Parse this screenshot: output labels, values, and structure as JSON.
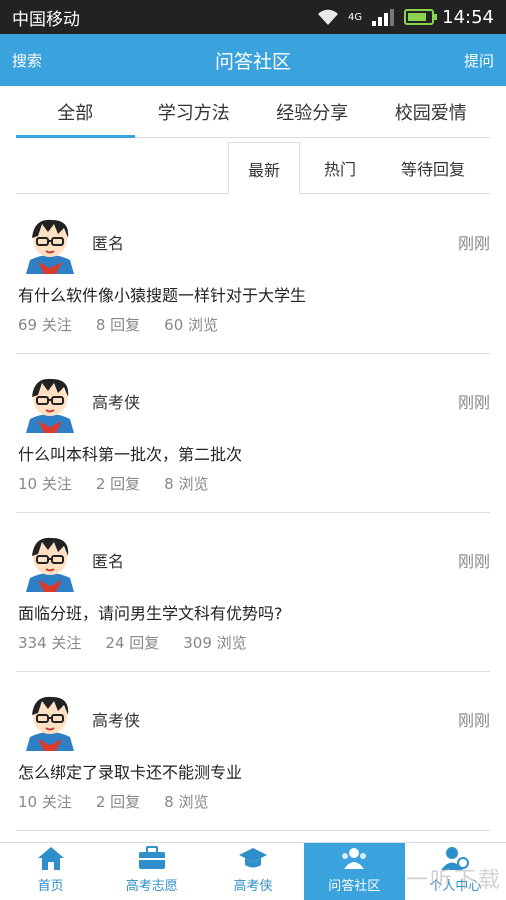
{
  "status_bar": {
    "carrier": "中国移动",
    "network": "4G",
    "time": "14:54"
  },
  "header": {
    "left": "搜索",
    "title": "问答社区",
    "right": "提问"
  },
  "categories": [
    {
      "label": "全部",
      "active": true
    },
    {
      "label": "学习方法",
      "active": false
    },
    {
      "label": "经验分享",
      "active": false
    },
    {
      "label": "校园爱情",
      "active": false
    }
  ],
  "sort_tabs": [
    {
      "label": "最新",
      "active": true
    },
    {
      "label": "热门",
      "active": false
    },
    {
      "label": "等待回复",
      "active": false
    }
  ],
  "posts": [
    {
      "author": "匿名",
      "time": "刚刚",
      "question": "有什么软件像小猿搜题一样针对于大学生",
      "follows": "69 关注",
      "replies": "8 回复",
      "views": "60 浏览"
    },
    {
      "author": "高考侠",
      "time": "刚刚",
      "question": "什么叫本科第一批次，第二批次",
      "follows": "10 关注",
      "replies": "2 回复",
      "views": "8 浏览"
    },
    {
      "author": "匿名",
      "time": "刚刚",
      "question": "面临分班，请问男生学文科有优势吗?",
      "follows": "334 关注",
      "replies": "24 回复",
      "views": "309 浏览"
    },
    {
      "author": "高考侠",
      "time": "刚刚",
      "question": "怎么绑定了录取卡还不能测专业",
      "follows": "10 关注",
      "replies": "2 回复",
      "views": "8 浏览"
    }
  ],
  "bottom_nav": [
    {
      "label": "首页",
      "icon": "home-icon"
    },
    {
      "label": "高考志愿",
      "icon": "briefcase-icon"
    },
    {
      "label": "高考侠",
      "icon": "graduation-cap-icon"
    },
    {
      "label": "问答社区",
      "icon": "community-icon",
      "active": true
    },
    {
      "label": "个人中心",
      "icon": "user-settings-icon"
    }
  ],
  "watermark": "一听下载",
  "colors": {
    "accent": "#3aa3dd",
    "status_bar": "#222222",
    "battery": "#8bd24e"
  }
}
